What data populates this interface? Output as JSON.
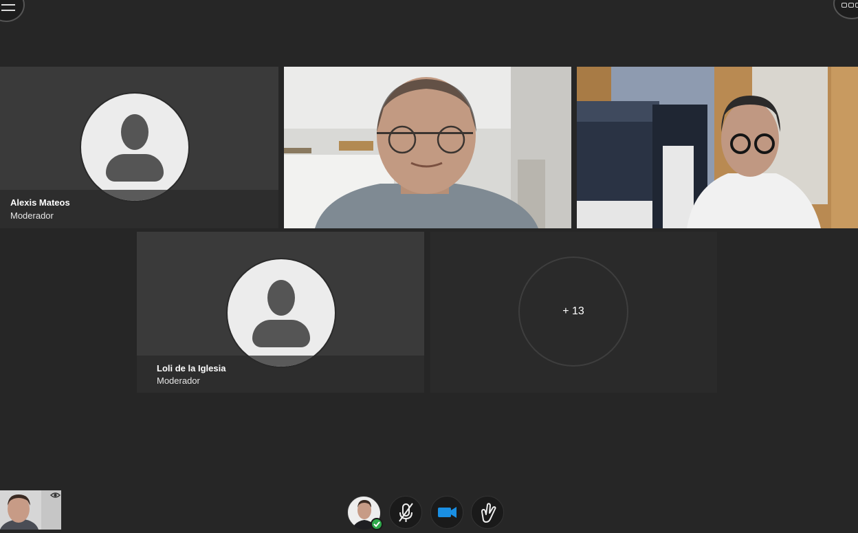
{
  "participants": [
    {
      "name": "Alexis Mateos",
      "role": "Moderador"
    },
    {
      "name": "Loli de la Iglesia",
      "role": "Moderador"
    }
  ],
  "overflow": {
    "label": "+ 13"
  },
  "icons": {
    "menu": "hamburger-menu-icon",
    "layout": "grid-layout-icon",
    "self_visibility": "eye-icon",
    "status": "check-icon",
    "microphone": "microphone-muted-icon",
    "camera": "video-camera-icon",
    "raise_hand": "raise-hand-icon"
  },
  "colors": {
    "background": "#262626",
    "tile": "#2d2d2d",
    "camera_accent": "#1a8fe3",
    "status_green": "#2ea84a"
  }
}
